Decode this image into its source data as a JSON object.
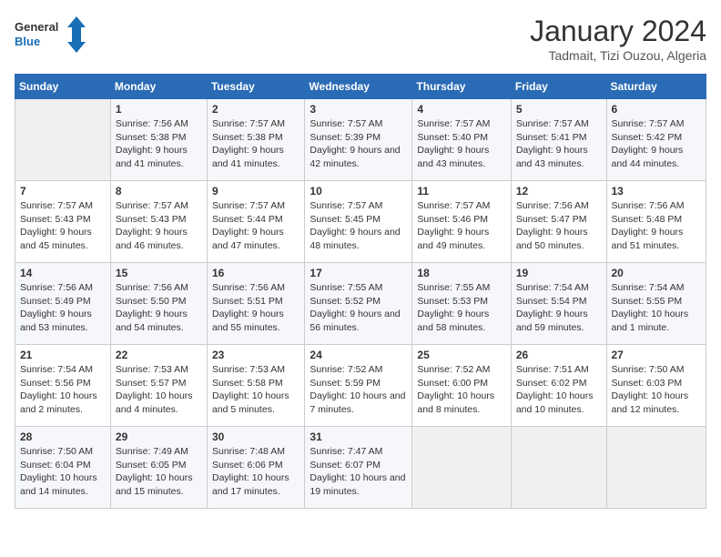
{
  "header": {
    "logo_line1": "General",
    "logo_line2": "Blue",
    "month": "January 2024",
    "location": "Tadmait, Tizi Ouzou, Algeria"
  },
  "days_of_week": [
    "Sunday",
    "Monday",
    "Tuesday",
    "Wednesday",
    "Thursday",
    "Friday",
    "Saturday"
  ],
  "weeks": [
    [
      {
        "num": "",
        "sunrise": "",
        "sunset": "",
        "daylight": ""
      },
      {
        "num": "1",
        "sunrise": "Sunrise: 7:56 AM",
        "sunset": "Sunset: 5:38 PM",
        "daylight": "Daylight: 9 hours and 41 minutes."
      },
      {
        "num": "2",
        "sunrise": "Sunrise: 7:57 AM",
        "sunset": "Sunset: 5:38 PM",
        "daylight": "Daylight: 9 hours and 41 minutes."
      },
      {
        "num": "3",
        "sunrise": "Sunrise: 7:57 AM",
        "sunset": "Sunset: 5:39 PM",
        "daylight": "Daylight: 9 hours and 42 minutes."
      },
      {
        "num": "4",
        "sunrise": "Sunrise: 7:57 AM",
        "sunset": "Sunset: 5:40 PM",
        "daylight": "Daylight: 9 hours and 43 minutes."
      },
      {
        "num": "5",
        "sunrise": "Sunrise: 7:57 AM",
        "sunset": "Sunset: 5:41 PM",
        "daylight": "Daylight: 9 hours and 43 minutes."
      },
      {
        "num": "6",
        "sunrise": "Sunrise: 7:57 AM",
        "sunset": "Sunset: 5:42 PM",
        "daylight": "Daylight: 9 hours and 44 minutes."
      }
    ],
    [
      {
        "num": "7",
        "sunrise": "Sunrise: 7:57 AM",
        "sunset": "Sunset: 5:43 PM",
        "daylight": "Daylight: 9 hours and 45 minutes."
      },
      {
        "num": "8",
        "sunrise": "Sunrise: 7:57 AM",
        "sunset": "Sunset: 5:43 PM",
        "daylight": "Daylight: 9 hours and 46 minutes."
      },
      {
        "num": "9",
        "sunrise": "Sunrise: 7:57 AM",
        "sunset": "Sunset: 5:44 PM",
        "daylight": "Daylight: 9 hours and 47 minutes."
      },
      {
        "num": "10",
        "sunrise": "Sunrise: 7:57 AM",
        "sunset": "Sunset: 5:45 PM",
        "daylight": "Daylight: 9 hours and 48 minutes."
      },
      {
        "num": "11",
        "sunrise": "Sunrise: 7:57 AM",
        "sunset": "Sunset: 5:46 PM",
        "daylight": "Daylight: 9 hours and 49 minutes."
      },
      {
        "num": "12",
        "sunrise": "Sunrise: 7:56 AM",
        "sunset": "Sunset: 5:47 PM",
        "daylight": "Daylight: 9 hours and 50 minutes."
      },
      {
        "num": "13",
        "sunrise": "Sunrise: 7:56 AM",
        "sunset": "Sunset: 5:48 PM",
        "daylight": "Daylight: 9 hours and 51 minutes."
      }
    ],
    [
      {
        "num": "14",
        "sunrise": "Sunrise: 7:56 AM",
        "sunset": "Sunset: 5:49 PM",
        "daylight": "Daylight: 9 hours and 53 minutes."
      },
      {
        "num": "15",
        "sunrise": "Sunrise: 7:56 AM",
        "sunset": "Sunset: 5:50 PM",
        "daylight": "Daylight: 9 hours and 54 minutes."
      },
      {
        "num": "16",
        "sunrise": "Sunrise: 7:56 AM",
        "sunset": "Sunset: 5:51 PM",
        "daylight": "Daylight: 9 hours and 55 minutes."
      },
      {
        "num": "17",
        "sunrise": "Sunrise: 7:55 AM",
        "sunset": "Sunset: 5:52 PM",
        "daylight": "Daylight: 9 hours and 56 minutes."
      },
      {
        "num": "18",
        "sunrise": "Sunrise: 7:55 AM",
        "sunset": "Sunset: 5:53 PM",
        "daylight": "Daylight: 9 hours and 58 minutes."
      },
      {
        "num": "19",
        "sunrise": "Sunrise: 7:54 AM",
        "sunset": "Sunset: 5:54 PM",
        "daylight": "Daylight: 9 hours and 59 minutes."
      },
      {
        "num": "20",
        "sunrise": "Sunrise: 7:54 AM",
        "sunset": "Sunset: 5:55 PM",
        "daylight": "Daylight: 10 hours and 1 minute."
      }
    ],
    [
      {
        "num": "21",
        "sunrise": "Sunrise: 7:54 AM",
        "sunset": "Sunset: 5:56 PM",
        "daylight": "Daylight: 10 hours and 2 minutes."
      },
      {
        "num": "22",
        "sunrise": "Sunrise: 7:53 AM",
        "sunset": "Sunset: 5:57 PM",
        "daylight": "Daylight: 10 hours and 4 minutes."
      },
      {
        "num": "23",
        "sunrise": "Sunrise: 7:53 AM",
        "sunset": "Sunset: 5:58 PM",
        "daylight": "Daylight: 10 hours and 5 minutes."
      },
      {
        "num": "24",
        "sunrise": "Sunrise: 7:52 AM",
        "sunset": "Sunset: 5:59 PM",
        "daylight": "Daylight: 10 hours and 7 minutes."
      },
      {
        "num": "25",
        "sunrise": "Sunrise: 7:52 AM",
        "sunset": "Sunset: 6:00 PM",
        "daylight": "Daylight: 10 hours and 8 minutes."
      },
      {
        "num": "26",
        "sunrise": "Sunrise: 7:51 AM",
        "sunset": "Sunset: 6:02 PM",
        "daylight": "Daylight: 10 hours and 10 minutes."
      },
      {
        "num": "27",
        "sunrise": "Sunrise: 7:50 AM",
        "sunset": "Sunset: 6:03 PM",
        "daylight": "Daylight: 10 hours and 12 minutes."
      }
    ],
    [
      {
        "num": "28",
        "sunrise": "Sunrise: 7:50 AM",
        "sunset": "Sunset: 6:04 PM",
        "daylight": "Daylight: 10 hours and 14 minutes."
      },
      {
        "num": "29",
        "sunrise": "Sunrise: 7:49 AM",
        "sunset": "Sunset: 6:05 PM",
        "daylight": "Daylight: 10 hours and 15 minutes."
      },
      {
        "num": "30",
        "sunrise": "Sunrise: 7:48 AM",
        "sunset": "Sunset: 6:06 PM",
        "daylight": "Daylight: 10 hours and 17 minutes."
      },
      {
        "num": "31",
        "sunrise": "Sunrise: 7:47 AM",
        "sunset": "Sunset: 6:07 PM",
        "daylight": "Daylight: 10 hours and 19 minutes."
      },
      {
        "num": "",
        "sunrise": "",
        "sunset": "",
        "daylight": ""
      },
      {
        "num": "",
        "sunrise": "",
        "sunset": "",
        "daylight": ""
      },
      {
        "num": "",
        "sunrise": "",
        "sunset": "",
        "daylight": ""
      }
    ]
  ]
}
